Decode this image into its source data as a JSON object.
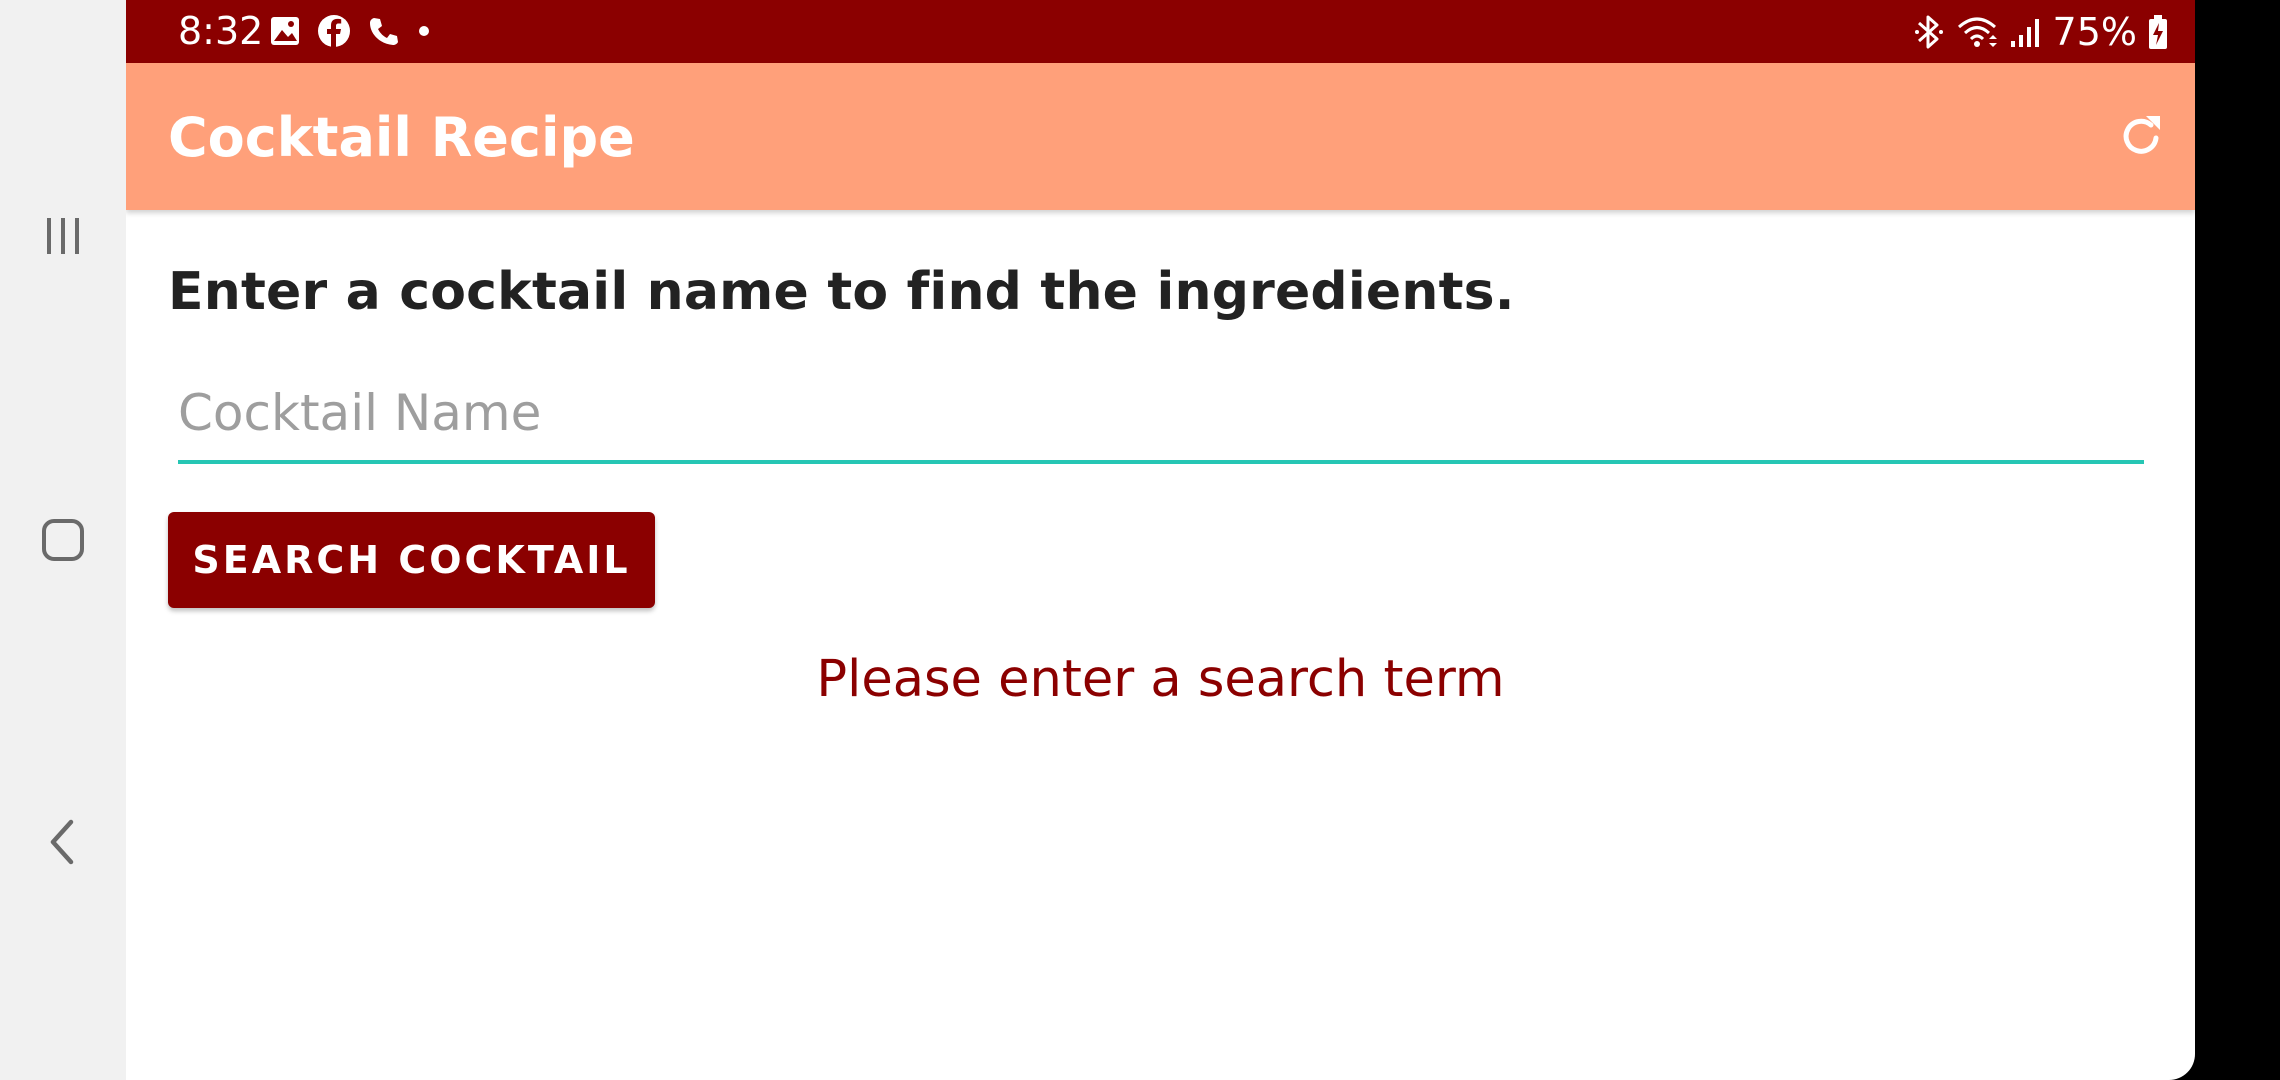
{
  "status_bar": {
    "time": "8:32",
    "battery": "75%",
    "left_icons": [
      "gallery-icon",
      "facebook-icon",
      "phone-icon",
      "dot-icon"
    ],
    "right_icons": [
      "bluetooth-icon",
      "wifi-icon",
      "signal-icon",
      "battery-charging-icon"
    ]
  },
  "toolbar": {
    "title": "Cocktail Recipe",
    "action_icon": "refresh-icon"
  },
  "main": {
    "prompt": "Enter a cocktail name to find the ingredients.",
    "input": {
      "value": "",
      "placeholder": "Cocktail Name"
    },
    "search_button": "SEARCH COCKTAIL",
    "error_message": "Please enter a search term"
  },
  "nav_bar": {
    "buttons": [
      "recents-icon",
      "home-icon",
      "back-icon"
    ]
  },
  "colors": {
    "status_bar": "#8b0000",
    "toolbar": "#ffa07a",
    "accent": "#26c6b4",
    "button": "#8b0000",
    "error": "#8b0000"
  }
}
